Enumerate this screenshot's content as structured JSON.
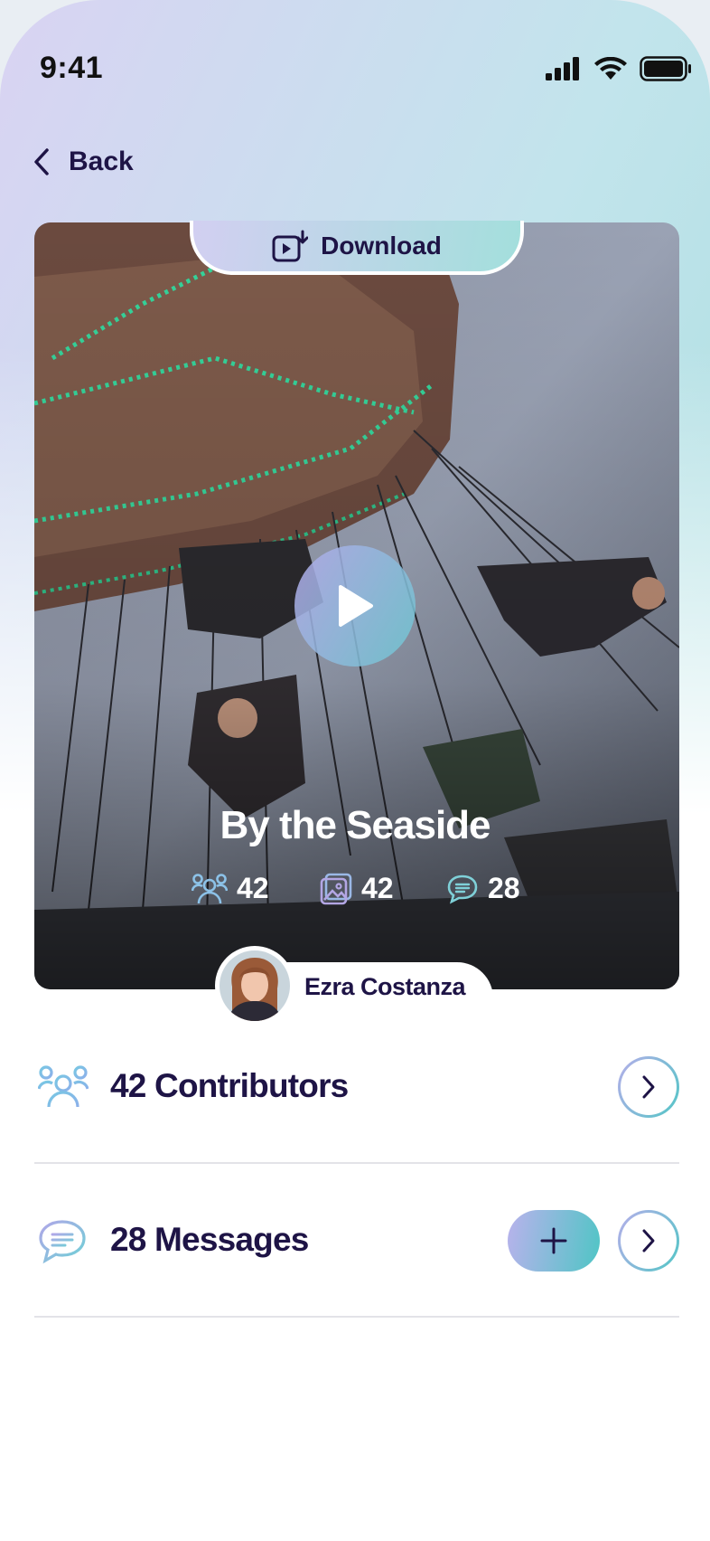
{
  "status_bar": {
    "time": "9:41"
  },
  "nav": {
    "back_label": "Back"
  },
  "media": {
    "download_label": "Download",
    "title": "By the Seaside",
    "stats": {
      "contributors": "42",
      "photos": "42",
      "messages": "28"
    },
    "author_name": "Ezra Costanza"
  },
  "sections": {
    "contributors_label": "42 Contributors",
    "messages_label": "28 Messages"
  },
  "colors": {
    "accent_start": "#b6aeea",
    "accent_end": "#52c6c6",
    "text_dark": "#1e1446"
  },
  "icons": [
    "back-chevron-icon",
    "download-video-icon",
    "play-icon",
    "people-icon",
    "image-icon",
    "chat-icon",
    "chevron-right-icon",
    "plus-icon"
  ]
}
